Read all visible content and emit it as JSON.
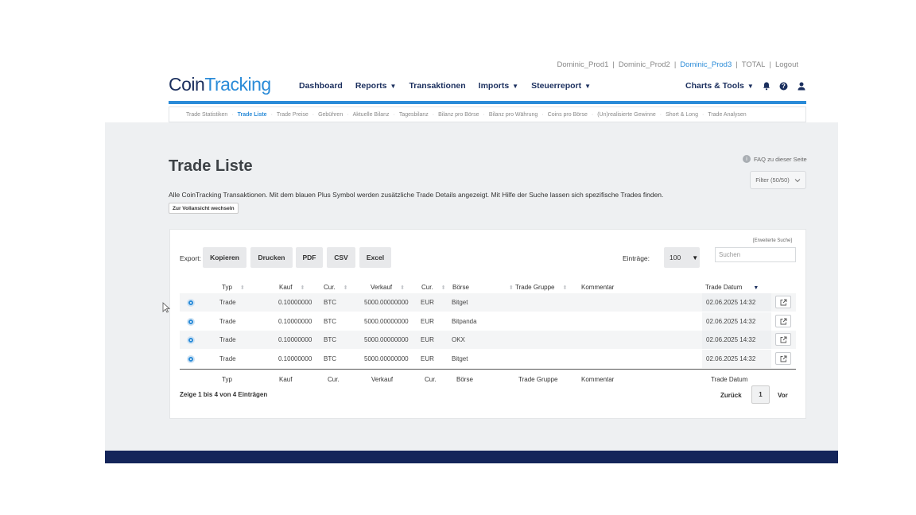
{
  "accounts": {
    "items": [
      "Dominic_Prod1",
      "Dominic_Prod2",
      "Dominic_Prod3",
      "TOTAL",
      "Logout"
    ],
    "active": "Dominic_Prod3"
  },
  "logo": {
    "part1": "Coin",
    "part2": "Tracking"
  },
  "mainnav": {
    "dashboard": "Dashboard",
    "reports": "Reports",
    "transaktionen": "Transaktionen",
    "imports": "Imports",
    "steuerreport": "Steuerreport",
    "charts": "Charts & Tools"
  },
  "subnav": [
    "Trade Statistiken",
    "Trade Liste",
    "Trade Preise",
    "Gebühren",
    "Aktuelle Bilanz",
    "Tagesbilanz",
    "Bilanz pro Börse",
    "Bilanz pro Währung",
    "Coins pro Börse",
    "(Un)realisierte Gewinne",
    "Short & Long",
    "Trade Analysen"
  ],
  "subnav_active": "Trade Liste",
  "page": {
    "title": "Trade Liste",
    "faq": "FAQ zu dieser Seite",
    "filter": "Filter (50/50)",
    "description": "Alle CoinTracking Transaktionen. Mit dem blauen Plus Symbol werden zusätzliche Trade Details angezeigt. Mit Hilfe der Suche lassen sich spezifische Trades finden.",
    "full_view": "Zur Vollansicht wechseln"
  },
  "table_tools": {
    "advanced_search": "[Erweiterte Suche]",
    "export_label": "Export:",
    "export_buttons": [
      "Kopieren",
      "Drucken",
      "PDF",
      "CSV",
      "Excel"
    ],
    "entries_label": "Einträge:",
    "entries_value": "100",
    "search_placeholder": "Suchen"
  },
  "table": {
    "headers": [
      "Typ",
      "Kauf",
      "Cur.",
      "Verkauf",
      "Cur.",
      "Börse",
      "Trade Gruppe",
      "Kommentar",
      "Trade Datum"
    ],
    "rows": [
      [
        "Trade",
        "0.10000000",
        "BTC",
        "5000.00000000",
        "EUR",
        "Bitget",
        "",
        "",
        "02.06.2025 14:32"
      ],
      [
        "Trade",
        "0.10000000",
        "BTC",
        "5000.00000000",
        "EUR",
        "Bitpanda",
        "",
        "",
        "02.06.2025 14:32"
      ],
      [
        "Trade",
        "0.10000000",
        "BTC",
        "5000.00000000",
        "EUR",
        "OKX",
        "",
        "",
        "02.06.2025 14:32"
      ],
      [
        "Trade",
        "0.10000000",
        "BTC",
        "5000.00000000",
        "EUR",
        "Bitget",
        "",
        "",
        "02.06.2025 14:32"
      ]
    ]
  },
  "footer": {
    "info": "Zeige 1 bis 4 von 4 Einträgen",
    "prev": "Zurück",
    "page": "1",
    "next": "Vor"
  },
  "colors": {
    "accent": "#2a8bd8",
    "navy": "#1b2f5e",
    "bg": "#eef0f2"
  }
}
